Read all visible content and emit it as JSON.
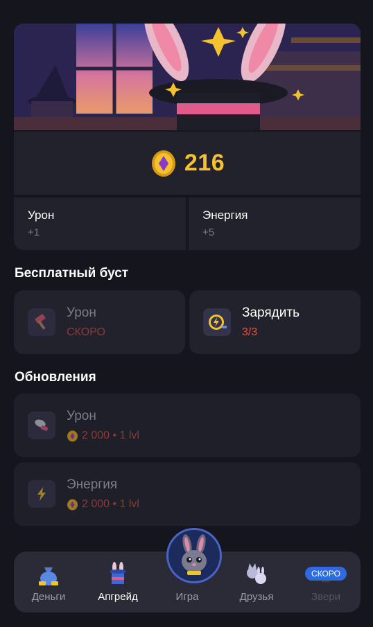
{
  "balance": {
    "value": "216",
    "icon": "coin-icon"
  },
  "stats": [
    {
      "label": "Урон",
      "value": "+1"
    },
    {
      "label": "Энергия",
      "value": "+5"
    }
  ],
  "free_boost": {
    "title": "Бесплатный буст",
    "items": [
      {
        "label": "Урон",
        "status": "СКОРО",
        "icon": "hammer-icon"
      },
      {
        "label": "Зарядить",
        "status": "3/3",
        "icon": "lightning-charge-icon"
      }
    ]
  },
  "upgrades": {
    "title": "Обновления",
    "items": [
      {
        "label": "Урон",
        "price": "2 000 • 1 lvl",
        "icon": "glove-icon"
      },
      {
        "label": "Энергия",
        "price": "2 000 • 1 lvl",
        "icon": "lightning-icon"
      }
    ]
  },
  "nav": {
    "items": [
      {
        "label": "Деньги",
        "icon": "money-bag-icon"
      },
      {
        "label": "Апгрейд",
        "icon": "magic-hat-icon"
      },
      {
        "label": "Игра",
        "icon": "bunny-avatar-icon"
      },
      {
        "label": "Друзья",
        "icon": "friends-icon"
      },
      {
        "label": "Звери",
        "icon": "animals-icon",
        "badge": "СКОРО"
      }
    ],
    "active": "Апгрейд"
  },
  "colors": {
    "accent": "#f4c22e",
    "danger": "#f04a3a",
    "card": "#22222c",
    "background": "#15151d"
  }
}
